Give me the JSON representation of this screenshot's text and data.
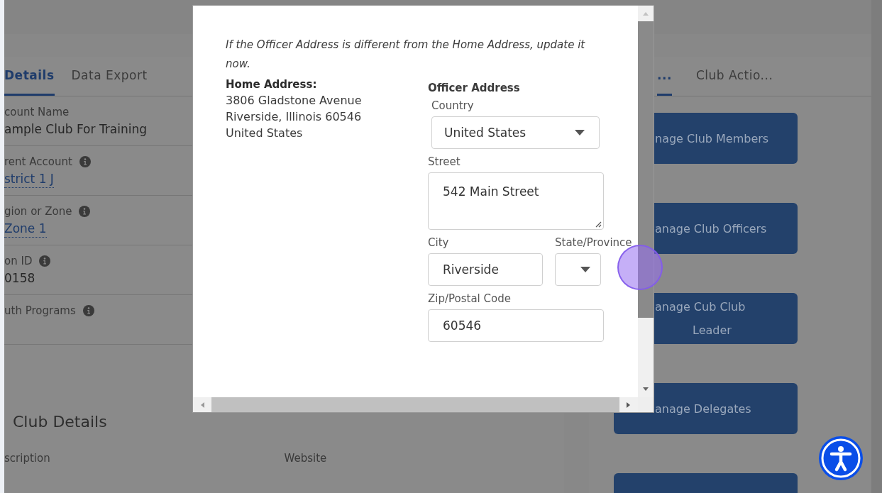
{
  "left_panel": {
    "tabs": [
      {
        "label": "Details",
        "selected": true
      },
      {
        "label": "Data Export",
        "selected": false
      }
    ],
    "fields": [
      {
        "label": "count Name",
        "value": "ample Club For Training",
        "info": false,
        "link": false
      },
      {
        "label": "rent Account",
        "value": "strict 1 J",
        "info": true,
        "link": true
      },
      {
        "label": "gion or Zone",
        "value": "Zone 1",
        "info": true,
        "link": true
      },
      {
        "label": "on ID",
        "value": "0158",
        "info": true,
        "link": false
      },
      {
        "label": "uth Programs",
        "info": true
      }
    ],
    "section": {
      "title": "Club Details",
      "columns": [
        "scription",
        "Website"
      ]
    }
  },
  "right_panel": {
    "tabs": [
      {
        "label": "...",
        "selected": true
      },
      {
        "label": "Club Actio...",
        "selected": false
      }
    ],
    "buttons": [
      {
        "lines": [
          "nage Club Members"
        ]
      },
      {
        "lines": [
          "anage Club Officers"
        ]
      },
      {
        "lines": [
          "anage Cub Club",
          "Leader"
        ]
      },
      {
        "lines": [
          "anage Delegates"
        ]
      }
    ]
  },
  "modal": {
    "intro": "If the Officer Address is different from the Home Address, update it now.",
    "home": {
      "heading": "Home Address:",
      "lines": [
        "3806 Gladstone Avenue",
        "Riverside, Illinois 60546",
        "United States"
      ]
    },
    "officer": {
      "heading": "Officer Address",
      "country": {
        "label": "Country",
        "value": "United States"
      },
      "street": {
        "label": "Street",
        "value": "542 Main Street"
      },
      "city": {
        "label": "City",
        "value": "Riverside"
      },
      "state": {
        "label": "State/Province"
      },
      "zip": {
        "label": "Zip/Postal Code",
        "value": "60546"
      }
    }
  }
}
